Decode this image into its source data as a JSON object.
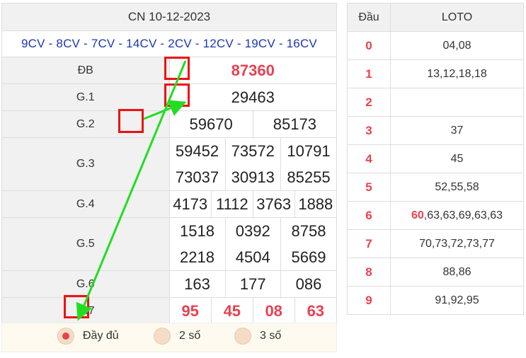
{
  "result": {
    "date": "CN 10-12-2023",
    "codes": "9CV - 8CV - 7CV - 14CV - 2CV - 12CV - 19CV - 16CV",
    "db": {
      "label": "ĐB",
      "value": "87360"
    },
    "g1": {
      "label": "G.1",
      "value": "29463"
    },
    "g2": {
      "label": "G.2",
      "values": [
        "59670",
        "85173"
      ]
    },
    "g3": {
      "label": "G.3",
      "values": [
        "59452",
        "73572",
        "10791",
        "73037",
        "30913",
        "85255"
      ]
    },
    "g4": {
      "label": "G.4",
      "values": [
        "4173",
        "1112",
        "3763",
        "1888"
      ]
    },
    "g5": {
      "label": "G.5",
      "values": [
        "1518",
        "0392",
        "8758",
        "2218",
        "4504",
        "5669"
      ]
    },
    "g6": {
      "label": "G.6",
      "values": [
        "163",
        "177",
        "086"
      ]
    },
    "g7": {
      "label": "G.7",
      "values": [
        "95",
        "45",
        "08",
        "63"
      ]
    }
  },
  "options": [
    {
      "label": "Đầy đủ",
      "selected": true
    },
    {
      "label": "2 số",
      "selected": false
    },
    {
      "label": "3 số",
      "selected": false
    }
  ],
  "loto": {
    "header_dau": "Đầu",
    "header_loto": "LOTO",
    "rows": [
      {
        "dau": "0",
        "values": "04,08"
      },
      {
        "dau": "1",
        "values": "13,12,18,18"
      },
      {
        "dau": "2",
        "values": ""
      },
      {
        "dau": "3",
        "values": "37"
      },
      {
        "dau": "4",
        "values": "45"
      },
      {
        "dau": "5",
        "values": "52,55,58"
      },
      {
        "dau": "6",
        "highlight": "60",
        "values": ",63,63,69,63,63"
      },
      {
        "dau": "7",
        "values": "70,73,72,73,77"
      },
      {
        "dau": "8",
        "values": "88,86"
      },
      {
        "dau": "9",
        "values": "91,92,95"
      }
    ]
  },
  "colors": {
    "accent": "#e94150",
    "codes": "#1a35b8",
    "annotation": "#e11111",
    "arrow": "#22dd22"
  }
}
